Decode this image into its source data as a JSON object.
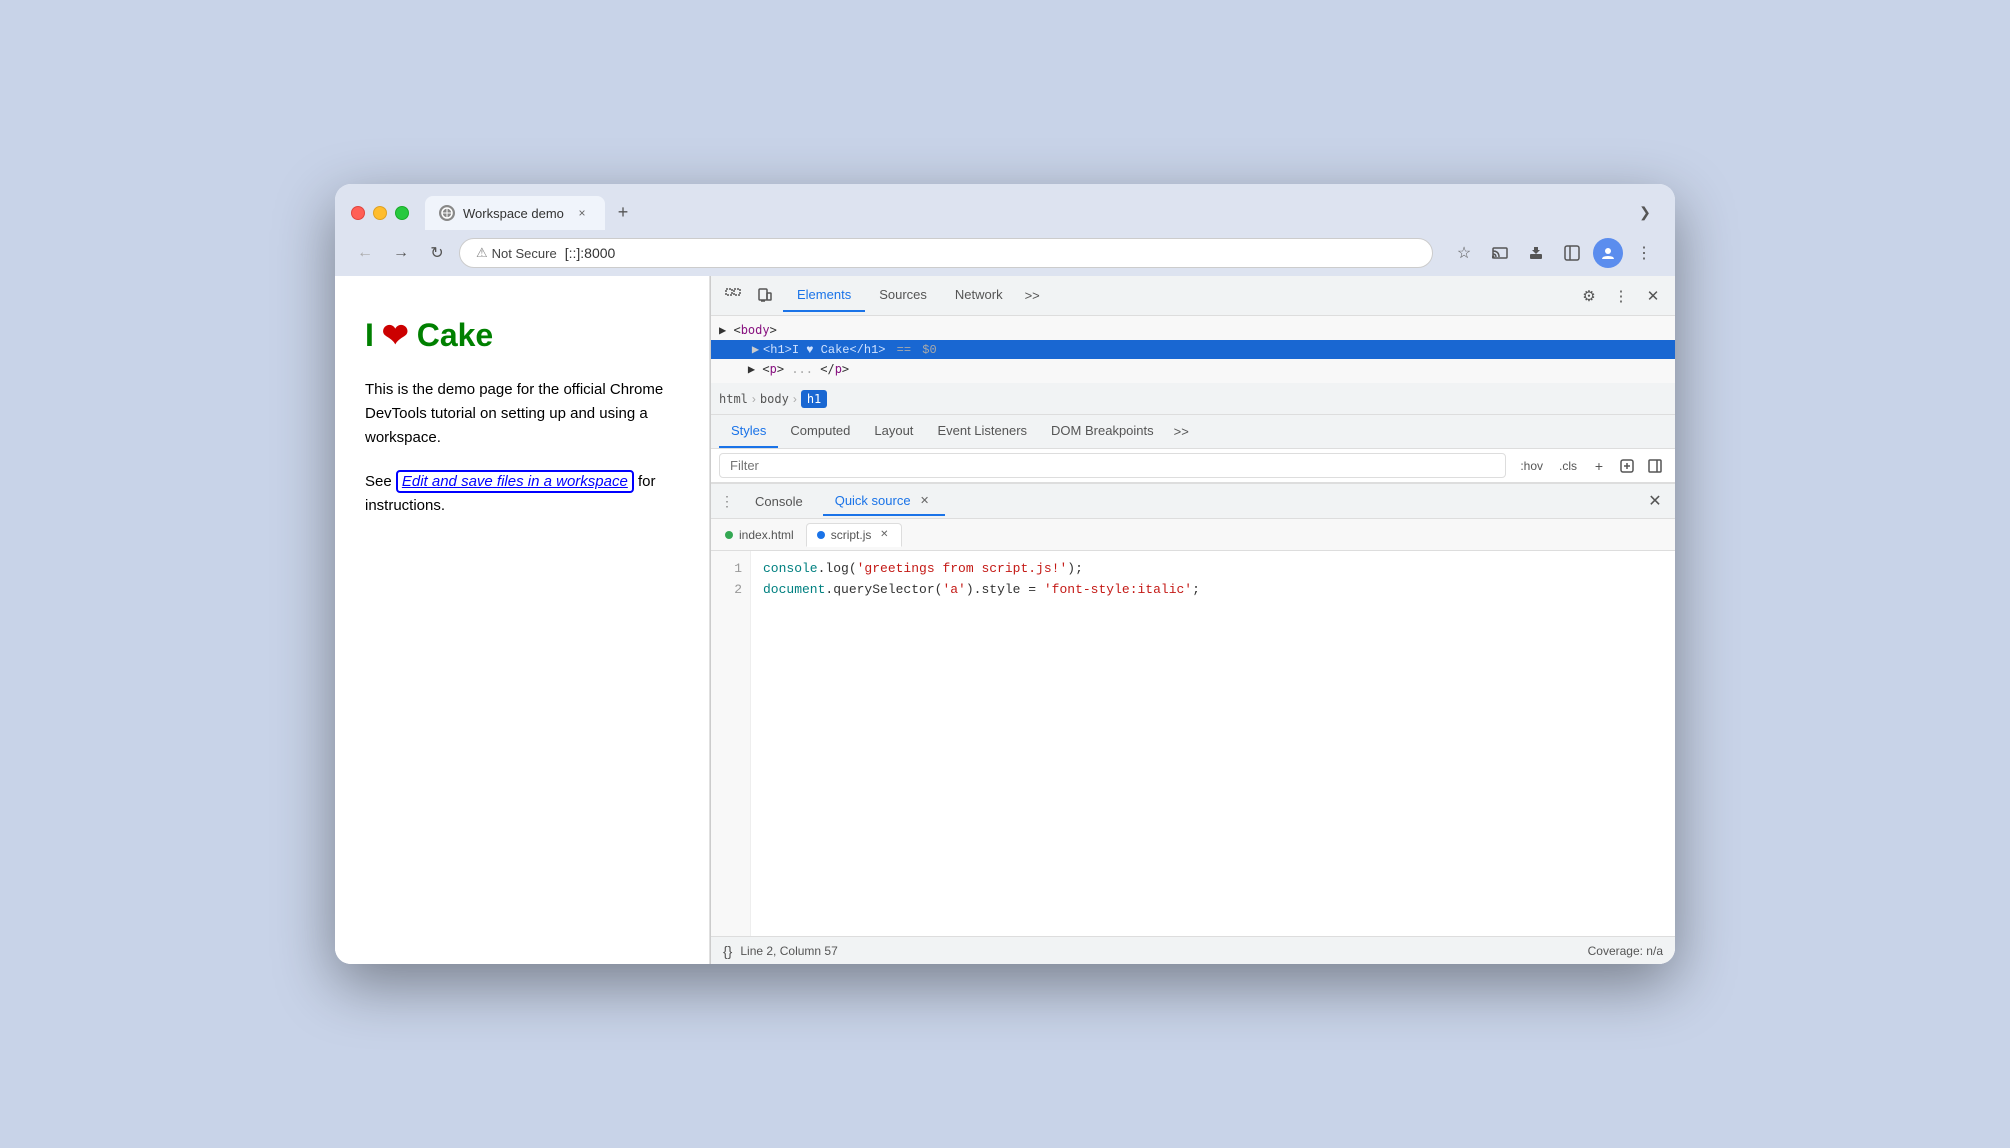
{
  "browser": {
    "tab_title": "Workspace demo",
    "tab_close": "×",
    "new_tab": "+",
    "dropdown": "❯",
    "back": "←",
    "forward": "→",
    "refresh": "↻",
    "not_secure_label": "Not Secure",
    "url": "[::]:8000",
    "bookmark_icon": "☆",
    "extensions_icon": "⬡",
    "profile_icon": "👤",
    "menu_icon": "⋮",
    "cast_icon": "▣"
  },
  "page": {
    "heading_green": "Cake",
    "heading_heart": "❤",
    "heading_prefix": "I",
    "description": "This is the demo page for the official Chrome DevTools tutorial on setting up and using a workspace.",
    "see_text": "See ",
    "link_text": "Edit and save files in a workspace",
    "see_suffix": " for instructions."
  },
  "devtools": {
    "tabs": [
      "Elements",
      "Sources",
      "Network"
    ],
    "active_tab": "Elements",
    "more_tabs": ">>",
    "settings_icon": "⚙",
    "dots_icon": "⋮",
    "close_icon": "×",
    "element_html": "<body>",
    "element_h1": "<h1>I ♥ Cake</h1>",
    "element_h1_eq": "==",
    "element_h1_dollar": "$0",
    "element_p": "<p>",
    "element_p_close": "</p>",
    "breadcrumb": [
      "html",
      "body",
      "h1"
    ],
    "styles_tabs": [
      "Styles",
      "Computed",
      "Layout",
      "Event Listeners",
      "DOM Breakpoints"
    ],
    "styles_active": "Styles",
    "styles_more": ">>",
    "filter_placeholder": "Filter",
    "filter_hov": ":hov",
    "filter_cls": ".cls",
    "filter_plus": "+",
    "filter_icon1": "▣",
    "filter_icon2": "◫",
    "console_tab": "Console",
    "quick_source_tab": "Quick source",
    "panel_close": "×",
    "panel_dots": "⋮",
    "file_tabs": [
      {
        "name": "index.html",
        "dot": "green",
        "active": false
      },
      {
        "name": "script.js",
        "dot": "blue",
        "active": true
      }
    ],
    "code_lines": [
      {
        "num": 1,
        "text": "console.log('greetings from script.js!');"
      },
      {
        "num": 2,
        "text": "document.querySelector('a').style = 'font-style:italic';"
      }
    ],
    "status_braces": "{}",
    "status_line_col": "Line 2, Column 57",
    "status_coverage": "Coverage: n/a"
  }
}
